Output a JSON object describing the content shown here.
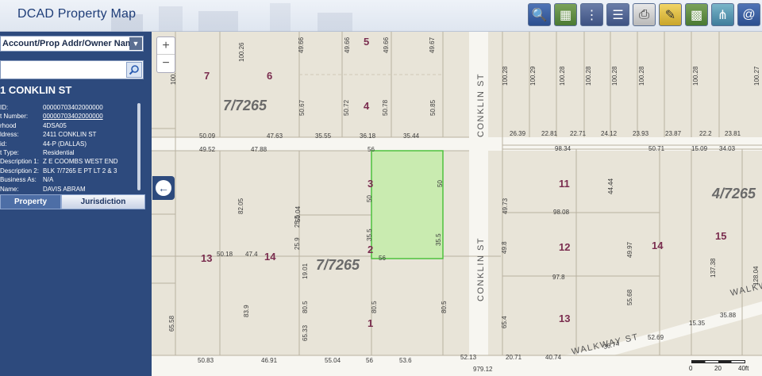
{
  "header": {
    "title": "DCAD Property Map",
    "tools": [
      {
        "icon": "zoom-search-icon",
        "glyph": "🔍"
      },
      {
        "icon": "map-layers-icon",
        "glyph": "▦"
      },
      {
        "icon": "parcel-numbers-icon",
        "glyph": "⋮"
      },
      {
        "icon": "list-icon",
        "glyph": "☰"
      },
      {
        "icon": "print-icon",
        "glyph": "⎙"
      },
      {
        "icon": "edit-notes-icon",
        "glyph": "✎"
      },
      {
        "icon": "grid-map-icon",
        "glyph": "▩"
      },
      {
        "icon": "share-icon",
        "glyph": "⋔"
      },
      {
        "icon": "email-icon",
        "glyph": "@"
      }
    ]
  },
  "sidebar": {
    "search_type": "Account/Prop Addr/Owner Name",
    "search_value": "",
    "address": "1 CONKLIN ST",
    "details": [
      {
        "key": "ID:",
        "value": "00000703402000000",
        "link": false
      },
      {
        "key": "t Number:",
        "value": "00000703402000000",
        "link": true
      },
      {
        "key": "rhood",
        "value": "4DSA05",
        "link": false
      },
      {
        "key": "ldress:",
        "value": "2411 CONKLIN ST",
        "link": false
      },
      {
        "key": "id:",
        "value": "44-P (DALLAS)",
        "link": false
      },
      {
        "key": "t Type:",
        "value": "Residential",
        "link": false
      },
      {
        "key": "Description 1:",
        "value": "Z E COOMBS WEST END",
        "link": false
      },
      {
        "key": "Description 2:",
        "value": "BLK 7/7265 E PT LT 2 & 3",
        "link": false
      },
      {
        "key": "Business As:",
        "value": "N/A",
        "link": false
      },
      {
        "key": "Name:",
        "value": "DAVIS ABRAM",
        "link": false
      }
    ],
    "tabs": {
      "property": "Property",
      "jurisdiction": "Jurisdiction"
    }
  },
  "map": {
    "zoom_in": "+",
    "zoom_out": "−",
    "blocks": [
      "7/7265",
      "7/7265",
      "4/7265"
    ],
    "lots": [
      "7",
      "6",
      "5",
      "4",
      "3",
      "2",
      "1",
      "13",
      "14",
      "11",
      "12",
      "14",
      "15",
      "13"
    ],
    "streets": [
      "CONKLIN ST",
      "CONKLIN ST",
      "WALKWAY ST",
      "WALKW"
    ],
    "dims": [
      "50.09",
      "47.63",
      "35.55",
      "36.18",
      "35.44",
      "49.52",
      "47.88",
      "56",
      "26.39",
      "22.81",
      "22.71",
      "24.12",
      "23.93",
      "23.87",
      "22.2",
      "23.81",
      "98.34",
      "50.71",
      "15.09",
      "34.03",
      "100.26",
      "49.66",
      "49.66",
      "49.66",
      "49.67",
      "100.28",
      "100.29",
      "100.28",
      "100.28",
      "100.28",
      "100.28",
      "100.28",
      "100.27",
      "50.67",
      "50.72",
      "50.78",
      "50.85",
      "100.",
      "49.73",
      "44.44",
      "98.08",
      "82.05",
      "50.04",
      "50",
      "50",
      "35.5",
      "35.5",
      "25.9",
      "25.5",
      "19.01",
      "50.18",
      "47.4",
      "56",
      "49.8",
      "97.8",
      "49.97",
      "137.38",
      "128.04",
      "83.9",
      "80.5",
      "80.5",
      "65.33",
      "80.5",
      "65.58",
      "65.4",
      "55.68",
      "50.83",
      "46.91",
      "55.04",
      "56",
      "53.6",
      "52.13",
      "20.71",
      "40.74",
      "979.12",
      "36.74",
      "52.69",
      "15.35",
      "35.88"
    ],
    "scale": {
      "zero": "0",
      "mid": "20",
      "end": "40ft"
    }
  },
  "colors": {
    "sidebar": "#2d4a7d",
    "selected_parcel": "#c9ebb0",
    "selected_border": "#4ec23e",
    "lot_number": "#7a2d4f"
  }
}
